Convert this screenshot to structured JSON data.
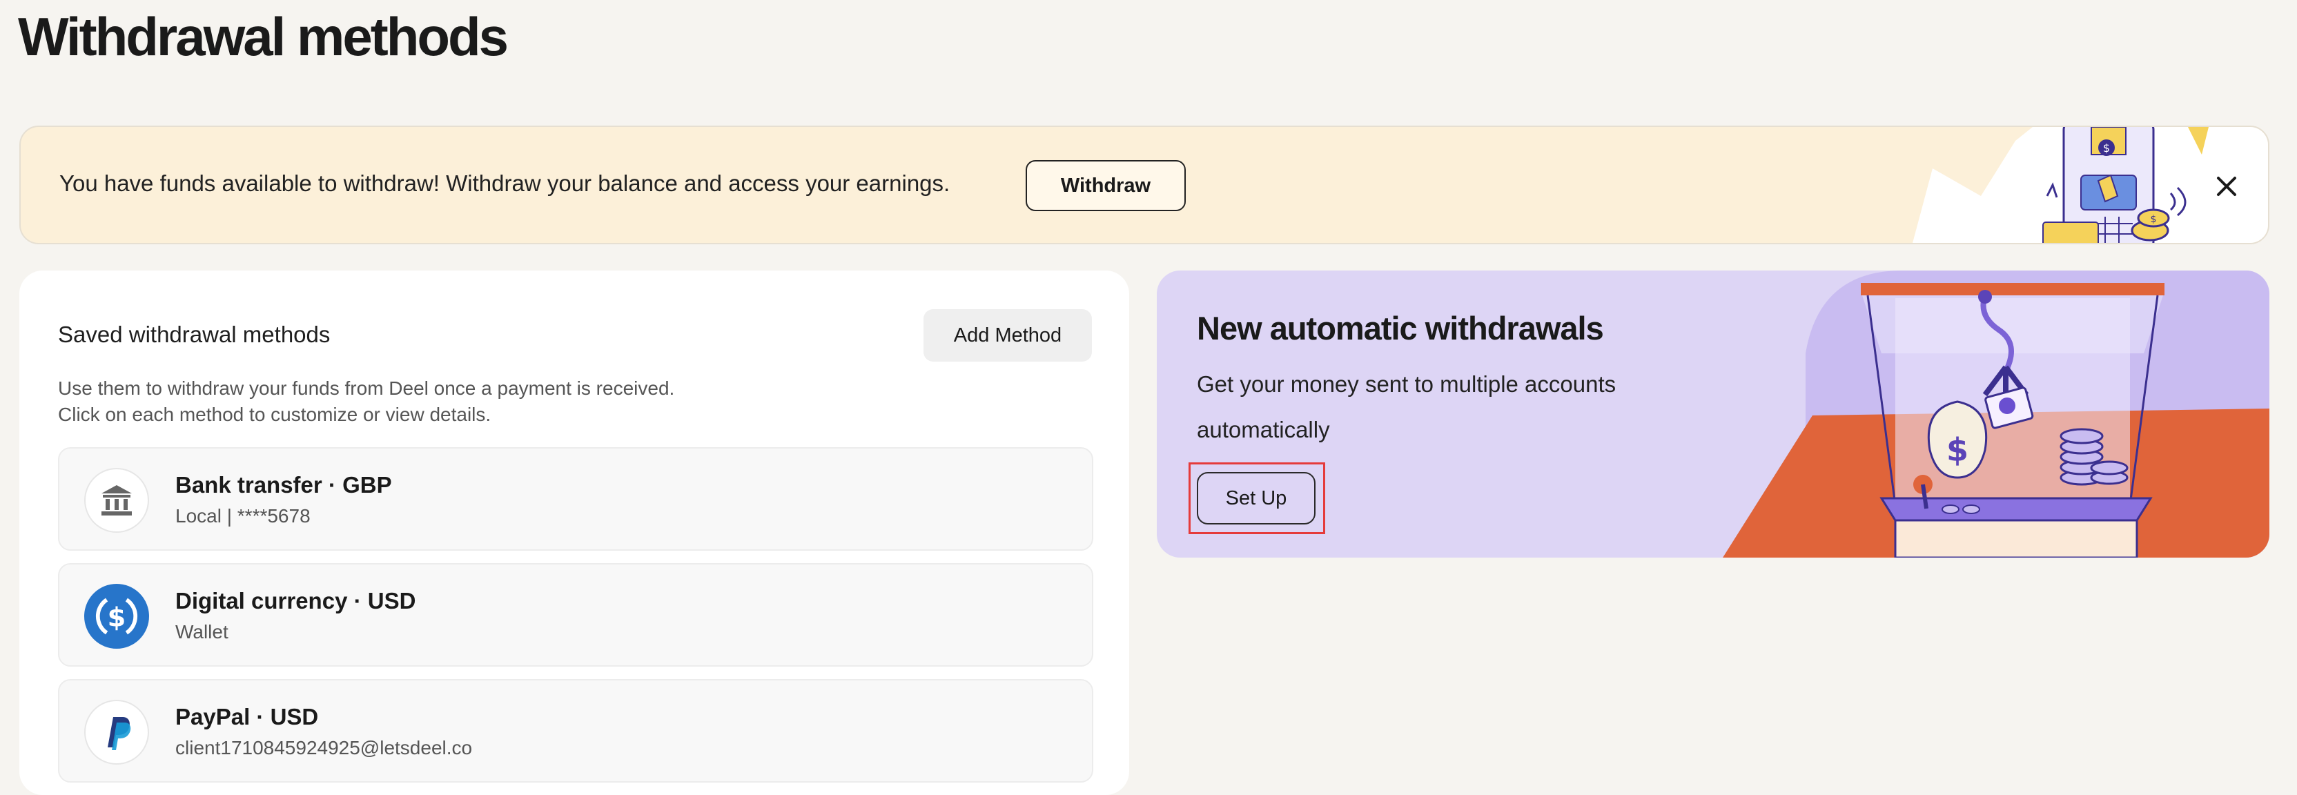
{
  "page": {
    "title": "Withdrawal methods"
  },
  "banner": {
    "text": "You have funds available to withdraw! Withdraw your balance and access your earnings.",
    "button_label": "Withdraw",
    "close_icon": "close-icon"
  },
  "saved": {
    "title": "Saved withdrawal methods",
    "add_button_label": "Add Method",
    "desc_line1": "Use them to withdraw your funds from Deel once a payment is received.",
    "desc_line2": "Click on each method to customize or view details.",
    "methods": [
      {
        "icon": "bank-icon",
        "title": "Bank transfer · GBP",
        "subtitle": "Local | ****5678"
      },
      {
        "icon": "usdc-icon",
        "title": "Digital currency · USD",
        "subtitle": "Wallet"
      },
      {
        "icon": "paypal-icon",
        "title": "PayPal · USD",
        "subtitle": "client1710845924925@letsdeel.co"
      }
    ]
  },
  "auto": {
    "title": "New automatic withdrawals",
    "desc": "Get your money sent to multiple accounts automatically",
    "button_label": "Set Up"
  },
  "colors": {
    "banner_bg": "#fcf0d9",
    "auto_card_bg": "#ddd5f5",
    "accent_purple": "#6a4fd0",
    "accent_orange": "#e0643a",
    "highlight_red": "#e53b3b"
  }
}
